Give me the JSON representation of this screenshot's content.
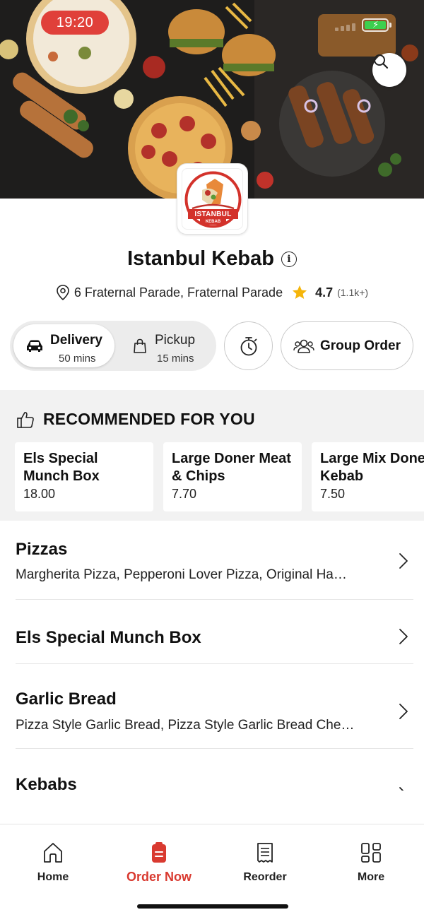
{
  "status_bar": {
    "time": "19:20"
  },
  "restaurant": {
    "name": "Istanbul Kebab",
    "logo_text": "ISTANBUL",
    "logo_subtext": "KEBAB",
    "address": "6 Fraternal Parade, Fraternal Parade",
    "rating": "4.7",
    "rating_count": "(1.1k+)"
  },
  "order_modes": {
    "delivery": {
      "label": "Delivery",
      "time": "50 mins",
      "selected": true
    },
    "pickup": {
      "label": "Pickup",
      "time": "15 mins",
      "selected": false
    }
  },
  "group_order_label": "Group Order",
  "recommended": {
    "title": "RECOMMENDED FOR YOU",
    "items": [
      {
        "name": "Els Special Munch Box",
        "price": "18.00"
      },
      {
        "name": "Large Doner Meat & Chips",
        "price": "7.70"
      },
      {
        "name": "Large Mix Doner Kebab",
        "price": "7.50"
      }
    ]
  },
  "categories": [
    {
      "title": "Pizzas",
      "description": "Margherita Pizza, Pepperoni Lover Pizza, Original Ha…"
    },
    {
      "title": "Els Special Munch Box",
      "description": ""
    },
    {
      "title": "Garlic Bread",
      "description": "Pizza Style Garlic Bread, Pizza Style Garlic Bread Che…"
    },
    {
      "title": "Kebabs",
      "description": ""
    }
  ],
  "bottom_nav": {
    "items": [
      {
        "label": "Home",
        "icon": "home-icon"
      },
      {
        "label": "Order Now",
        "icon": "order-icon"
      },
      {
        "label": "Reorder",
        "icon": "receipt-icon"
      },
      {
        "label": "More",
        "icon": "grid-icon"
      }
    ],
    "active": "Order Now"
  },
  "colors": {
    "accent": "#d93a30",
    "rating_star": "#f5b50a",
    "battery": "#3ccf4e"
  }
}
